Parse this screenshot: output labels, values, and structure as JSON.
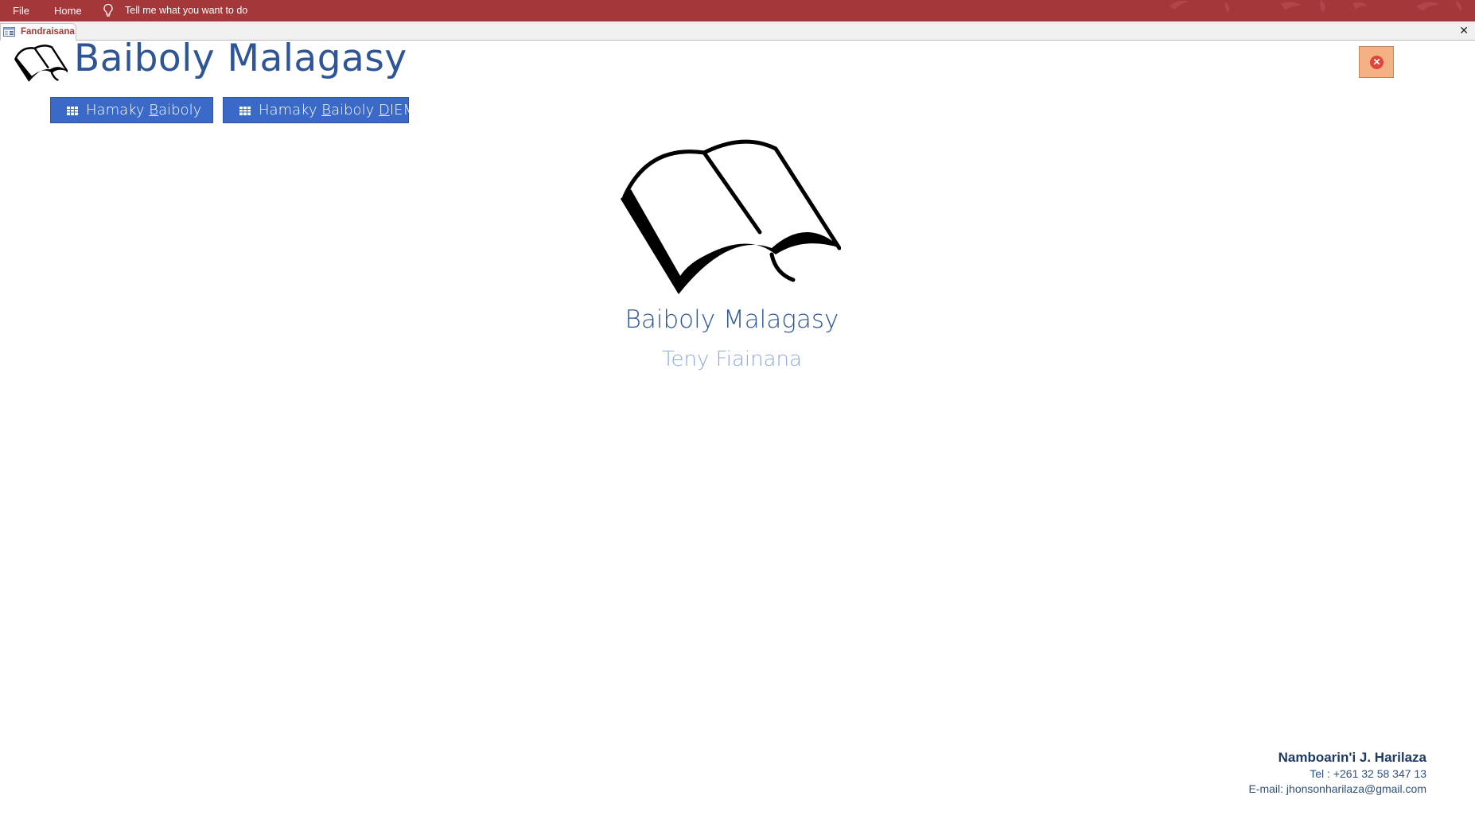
{
  "ribbon": {
    "file_label": "File",
    "home_label": "Home",
    "tell_me_placeholder": "Tell me what you want to do"
  },
  "document_tab": {
    "label": "Fandraisana",
    "close_symbol": "✕"
  },
  "form": {
    "header_title": "Baiboly Malagasy",
    "close_button_symbol": "✕",
    "buttons": {
      "hamaky_baiboly": {
        "pre": "Hamaky ",
        "hotkey": "B",
        "post": "aiboly"
      },
      "hamaky_baiboly_diem": {
        "pre": "Hamaky ",
        "hotkey": "B",
        "mid": "aiboly ",
        "hotkey2": "D",
        "post": "IEM"
      }
    },
    "center_title": "Baiboly Malagasy",
    "center_subtitle": "Teny Fiainana"
  },
  "footer": {
    "author": "Namboarin'i J. Harilaza",
    "tel": "Tel : +261 32 58 347 13",
    "email": "E-mail: jhonsonharilaza@gmail.com"
  },
  "icons": {
    "ribbon_tell": "lightbulb-icon",
    "doc_tab": "form-icon",
    "header_logo": "open-book-icon",
    "button_icon": "table-icon",
    "close": "close-circle-icon"
  },
  "colors": {
    "ribbon_bg": "#a4373a",
    "title_blue": "#2e5597",
    "subtitle_blue": "#8faadc",
    "button_blue": "#3a69c7",
    "close_button_bg": "#f4b183",
    "close_circle": "#e0453b"
  }
}
